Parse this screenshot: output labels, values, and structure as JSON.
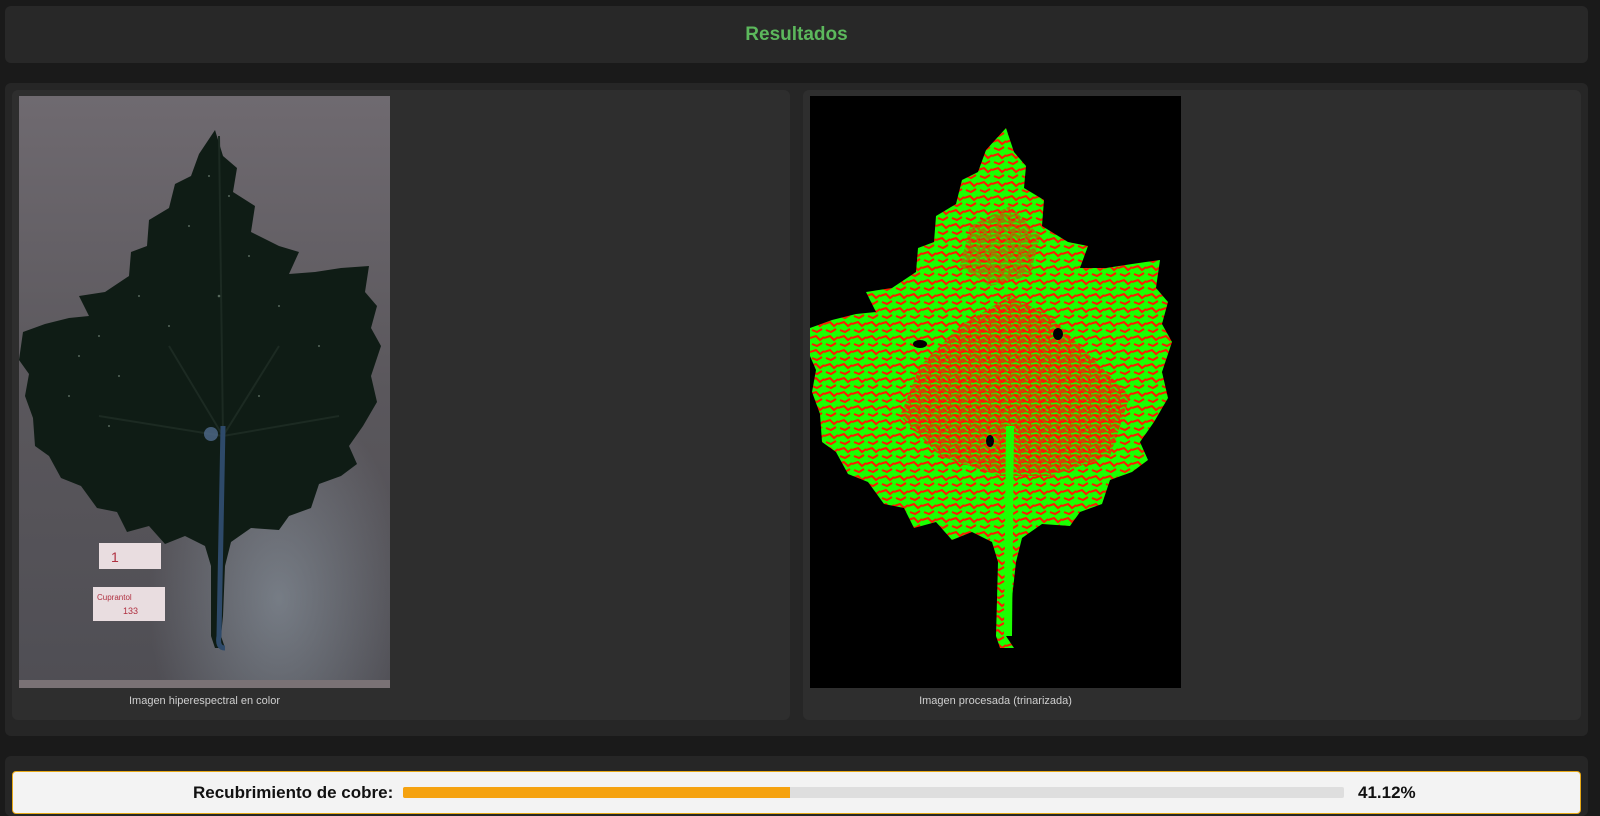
{
  "header": {
    "title": "Resultados"
  },
  "panels": [
    {
      "caption": "Imagen hiperespectral en color",
      "label_1": "1",
      "label_2_line1": "Cuprantol",
      "label_2_line2": "133"
    },
    {
      "caption": "Imagen procesada (trinarizada)"
    }
  ],
  "progress": {
    "label": "Recubrimiento de cobre:",
    "value_text": "41.12%",
    "fraction": 0.4112
  },
  "colors": {
    "title": "#5cb85c",
    "bar_fill": "#f5a20f",
    "healthy": "#00ff00",
    "copper": "#ff1a00"
  }
}
